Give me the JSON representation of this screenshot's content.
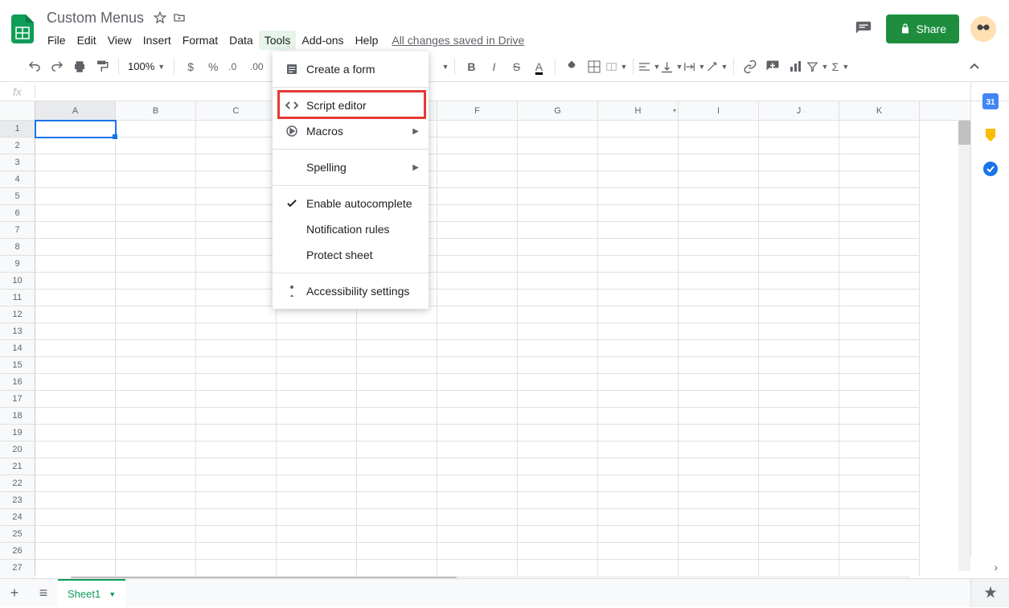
{
  "doc": {
    "title": "Custom Menus"
  },
  "menus": [
    "File",
    "Edit",
    "View",
    "Insert",
    "Format",
    "Data",
    "Tools",
    "Add-ons",
    "Help"
  ],
  "active_menu": "Tools",
  "saved_text": "All changes saved in Drive",
  "share_label": "Share",
  "zoom": "100%",
  "font": "Arial",
  "font_size": "10",
  "columns": [
    "A",
    "B",
    "C",
    "D",
    "E",
    "F",
    "G",
    "H",
    "I",
    "J",
    "K"
  ],
  "row_count": 27,
  "selected_cell": {
    "row": 1,
    "col": "A"
  },
  "sheet_tab": "Sheet1",
  "tools_menu": [
    {
      "icon": "form",
      "label": "Create a form"
    },
    {
      "sep": true
    },
    {
      "icon": "code",
      "label": "Script editor",
      "highlight": true
    },
    {
      "icon": "play",
      "label": "Macros",
      "submenu": true
    },
    {
      "sep": true
    },
    {
      "icon": "",
      "label": "Spelling",
      "submenu": true
    },
    {
      "sep": true
    },
    {
      "icon": "check",
      "label": "Enable autocomplete"
    },
    {
      "icon": "",
      "label": "Notification rules"
    },
    {
      "icon": "",
      "label": "Protect sheet"
    },
    {
      "sep": true
    },
    {
      "icon": "access",
      "label": "Accessibility settings"
    }
  ]
}
